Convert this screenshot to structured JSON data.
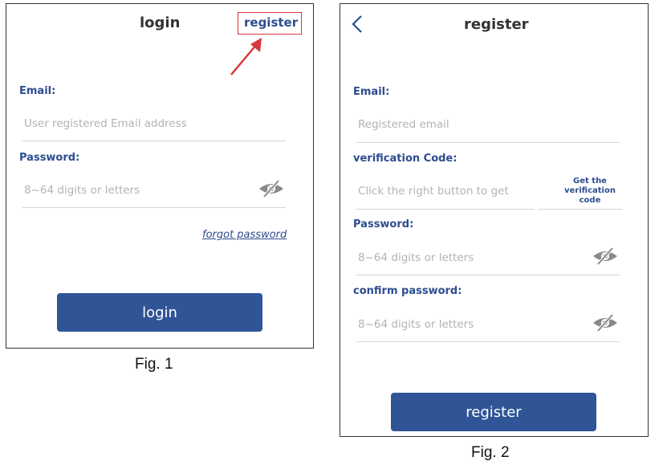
{
  "fig1": {
    "title": "login",
    "register_link": "register",
    "email_label": "Email:",
    "email_placeholder": "User registered Email address",
    "password_label": "Password:",
    "password_placeholder": "8~64 digits or letters",
    "forgot_password": "forgot password",
    "login_button": "login",
    "caption": "Fig. 1"
  },
  "fig2": {
    "title": "register",
    "email_label": "Email:",
    "email_placeholder": "Registered email",
    "code_label": "verification Code:",
    "code_placeholder": "Click the right button to get",
    "get_code_button": "Get the verification code",
    "password_label": "Password:",
    "password_placeholder": "8~64 digits or letters",
    "confirm_label": "confirm password:",
    "confirm_placeholder": "8~64 digits or letters",
    "register_button": "register",
    "caption": "Fig. 2"
  },
  "colors": {
    "accent": "#2d4d8f",
    "button": "#2f5597",
    "highlight": "#d7373f",
    "placeholder": "#b3b3b3"
  },
  "icons": [
    "eye-off-icon",
    "back-chevron-icon",
    "annotation-arrow-icon"
  ]
}
